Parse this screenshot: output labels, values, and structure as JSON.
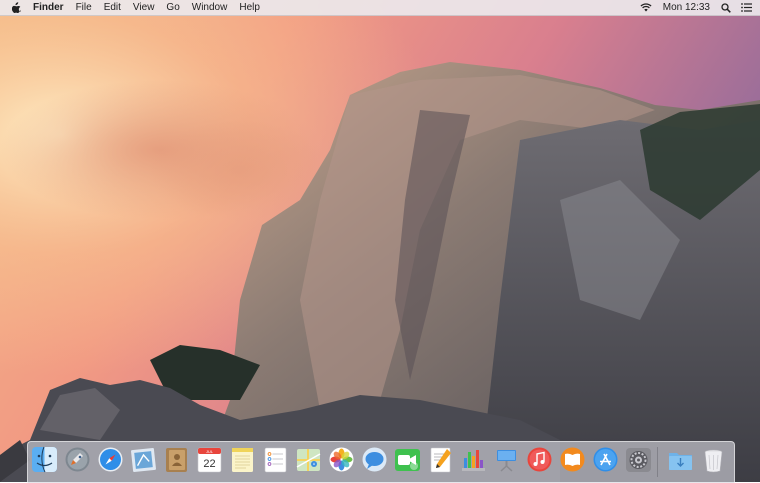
{
  "menubar": {
    "app_name": "Finder",
    "menus": [
      "File",
      "Edit",
      "View",
      "Go",
      "Window",
      "Help"
    ],
    "clock": "Mon 12:33"
  },
  "dock": {
    "apps": [
      {
        "icon": "finder-icon"
      },
      {
        "icon": "launchpad-icon"
      },
      {
        "icon": "safari-icon"
      },
      {
        "icon": "mail-icon"
      },
      {
        "icon": "contacts-icon"
      },
      {
        "icon": "calendar-icon",
        "month": "JUL",
        "day": "22"
      },
      {
        "icon": "notes-icon"
      },
      {
        "icon": "reminders-icon"
      },
      {
        "icon": "maps-icon"
      },
      {
        "icon": "photos-icon"
      },
      {
        "icon": "messages-icon"
      },
      {
        "icon": "facetime-icon"
      },
      {
        "icon": "pages-icon"
      },
      {
        "icon": "numbers-icon"
      },
      {
        "icon": "keynote-icon"
      },
      {
        "icon": "itunes-icon"
      },
      {
        "icon": "ibooks-icon"
      },
      {
        "icon": "app-store-icon"
      },
      {
        "icon": "system-preferences-icon"
      }
    ],
    "others": [
      {
        "icon": "downloads-folder-icon"
      },
      {
        "icon": "trash-icon"
      }
    ]
  }
}
